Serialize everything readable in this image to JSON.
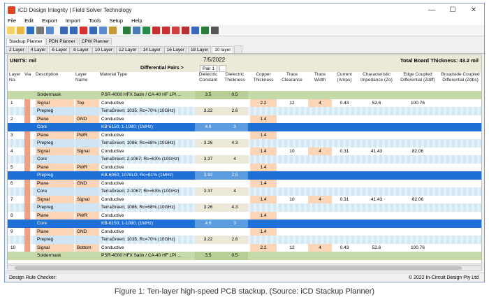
{
  "window": {
    "title": "iCD Design Integrity | Field Solver Technology",
    "minimize": "—",
    "maximize": "☐",
    "close": "✕"
  },
  "menu": [
    "File",
    "Edit",
    "Export",
    "Import",
    "Tools",
    "Setup",
    "Help"
  ],
  "toolbar_icons": [
    "new-file-icon",
    "open-folder-icon",
    "save-icon",
    "print-icon",
    "print-preview-icon",
    "undo-icon",
    "redo-icon",
    "delete-icon",
    "cut-icon",
    "copy-icon",
    "paste-icon",
    "stackup-icon",
    "impedance-chart-icon",
    "graph-icon",
    "graph-icon-2",
    "red-chart-icon",
    "red-chart-icon-2",
    "chart-icon-3",
    "chart-icon-4",
    "table-icon",
    "calendar-icon"
  ],
  "planner_tabs": [
    "Stackup Planner",
    "PDN Planner",
    "CPW Planner"
  ],
  "layer_tabs": [
    "2 Layer",
    "4 Layer",
    "6 Layer",
    "8 Layer",
    "10 Layer",
    "12 Layer",
    "14 Layer",
    "16 Layer",
    "18 Layer",
    "10 layer"
  ],
  "units": "UNITS: mil",
  "date": "7/5/2022",
  "total_thickness": "Total Board Thickness: 43.2 mil",
  "diff_pairs_label": "Differential Pairs >",
  "pair_tab": "Pair 1",
  "columns": {
    "layer_no": "Layer No.",
    "via": "Via",
    "description": "Description",
    "layer_name": "Layer Name",
    "material": "Material Type",
    "dk": "Dielectric Constant",
    "thickness": "Dielectric Thickness",
    "copper": "Copper Thickness",
    "clearance": "Trace Clearance",
    "width": "Trace Width",
    "current": "Current (Amps)",
    "zo": "Characteristic Impedance (Zo)",
    "zdiff": "Edge Coupled Differential (Zdiff)",
    "zdbs": "Broadside Coupled Differential (Zdbs)"
  },
  "rows": [
    {
      "type": "mask",
      "no": "",
      "desc": "Soldermask",
      "name": "",
      "mat": "PSR-4000 HFX Satin / CA-40 HF LPI ...",
      "dk": "3.5",
      "th": "0.5",
      "cu": "",
      "cl": "",
      "w": "",
      "cur": "",
      "zo": "",
      "zd": ""
    },
    {
      "type": "signal",
      "no": "1",
      "desc": "Signal",
      "name": "Top",
      "mat": "Conductive",
      "dk": "",
      "th": "",
      "cu": "2.2",
      "cl": "12",
      "w": "4",
      "cur": "0.43",
      "zo": "52.6",
      "zd": "100.76"
    },
    {
      "type": "preg",
      "no": "",
      "desc": "Prepreg",
      "name": "",
      "mat": "TerraGreen; 1035; Rc=70% (10GHz)",
      "dk": "3.22",
      "th": "2.6",
      "cu": "",
      "cl": "",
      "w": "",
      "cur": "",
      "zo": "",
      "zd": ""
    },
    {
      "type": "plane",
      "no": "2",
      "desc": "Plane",
      "name": "GND",
      "mat": "Conductive",
      "dk": "",
      "th": "",
      "cu": "1.4",
      "cl": "",
      "w": "",
      "cur": "",
      "zo": "",
      "zd": ""
    },
    {
      "type": "core",
      "no": "",
      "desc": "Core",
      "name": "",
      "mat": "KB-6150; 1-1080; (1MHz)",
      "dk": "4.6",
      "th": "3",
      "cu": "",
      "cl": "",
      "w": "",
      "cur": "",
      "zo": "",
      "zd": ""
    },
    {
      "type": "plane",
      "no": "3",
      "desc": "Plane",
      "name": "PWR",
      "mat": "Conductive",
      "dk": "",
      "th": "",
      "cu": "1.4",
      "cl": "",
      "w": "",
      "cur": "",
      "zo": "",
      "zd": ""
    },
    {
      "type": "preg",
      "no": "",
      "desc": "Prepreg",
      "name": "",
      "mat": "TerraGreen; 1086; Rc=68% (10GHz)",
      "dk": "3.26",
      "th": "4.3",
      "cu": "",
      "cl": "",
      "w": "",
      "cur": "",
      "zo": "",
      "zd": ""
    },
    {
      "type": "signal",
      "no": "4",
      "desc": "Signal",
      "name": "Signal",
      "mat": "Conductive",
      "dk": "",
      "th": "",
      "cu": "1.4",
      "cl": "10",
      "w": "4",
      "cur": "0.31",
      "zo": "41.43",
      "zd": "82.06"
    },
    {
      "type": "preg",
      "no": "",
      "desc": "Core",
      "name": "",
      "mat": "TerraGreen; 2-1067; Rc=63% (10GHz)",
      "dk": "3.37",
      "th": "4",
      "cu": "",
      "cl": "",
      "w": "",
      "cur": "",
      "zo": "",
      "zd": ""
    },
    {
      "type": "plane",
      "no": "5",
      "desc": "Plane",
      "name": "PWR",
      "mat": "Conductive",
      "dk": "",
      "th": "",
      "cu": "1.4",
      "cl": "",
      "w": "",
      "cur": "",
      "zo": "",
      "zd": ""
    },
    {
      "type": "core",
      "no": "",
      "desc": "Prepreg",
      "name": "",
      "mat": "KB-6050; 1078LD; Rc=61% (1MHz)",
      "dk": "3.92",
      "th": "2.6",
      "cu": "",
      "cl": "",
      "w": "",
      "cur": "",
      "zo": "",
      "zd": ""
    },
    {
      "type": "plane",
      "no": "6",
      "desc": "Plane",
      "name": "GND",
      "mat": "Conductive",
      "dk": "",
      "th": "",
      "cu": "1.4",
      "cl": "",
      "w": "",
      "cur": "",
      "zo": "",
      "zd": ""
    },
    {
      "type": "preg",
      "no": "",
      "desc": "Core",
      "name": "",
      "mat": "TerraGreen; 2-1067; Rc=63% (10GHz)",
      "dk": "3.37",
      "th": "4",
      "cu": "",
      "cl": "",
      "w": "",
      "cur": "",
      "zo": "",
      "zd": ""
    },
    {
      "type": "signal",
      "no": "7",
      "desc": "Signal",
      "name": "Signal",
      "mat": "Conductive",
      "dk": "",
      "th": "",
      "cu": "1.4",
      "cl": "10",
      "w": "4",
      "cur": "0.31",
      "zo": "41.43",
      "zd": "82.06"
    },
    {
      "type": "preg",
      "no": "",
      "desc": "Prepreg",
      "name": "",
      "mat": "TerraGreen; 1086; Rc=68% (10GHz)",
      "dk": "3.26",
      "th": "4.3",
      "cu": "",
      "cl": "",
      "w": "",
      "cur": "",
      "zo": "",
      "zd": ""
    },
    {
      "type": "plane",
      "no": "8",
      "desc": "Plane",
      "name": "PWR",
      "mat": "Conductive",
      "dk": "",
      "th": "",
      "cu": "1.4",
      "cl": "",
      "w": "",
      "cur": "",
      "zo": "",
      "zd": ""
    },
    {
      "type": "core",
      "no": "",
      "desc": "Core",
      "name": "",
      "mat": "KB-6150; 1-1080; (1MHz)",
      "dk": "4.6",
      "th": "3",
      "cu": "",
      "cl": "",
      "w": "",
      "cur": "",
      "zo": "",
      "zd": ""
    },
    {
      "type": "plane",
      "no": "9",
      "desc": "Plane",
      "name": "GND",
      "mat": "Conductive",
      "dk": "",
      "th": "",
      "cu": "1.4",
      "cl": "",
      "w": "",
      "cur": "",
      "zo": "",
      "zd": ""
    },
    {
      "type": "preg",
      "no": "",
      "desc": "Prepreg",
      "name": "",
      "mat": "TerraGreen; 1035; Rc=70% (10GHz)",
      "dk": "3.22",
      "th": "2.6",
      "cu": "",
      "cl": "",
      "w": "",
      "cur": "",
      "zo": "",
      "zd": ""
    },
    {
      "type": "signal",
      "no": "10",
      "desc": "Signal",
      "name": "Bottom",
      "mat": "Conductive",
      "dk": "",
      "th": "",
      "cu": "2.2",
      "cl": "12",
      "w": "4",
      "cur": "0.43",
      "zo": "52.6",
      "zd": "100.76"
    },
    {
      "type": "mask",
      "no": "",
      "desc": "Soldermask",
      "name": "",
      "mat": "PSR-4000 HFX Satin / CA-40 HF LPI ...",
      "dk": "3.5",
      "th": "0.5",
      "cu": "",
      "cl": "",
      "w": "",
      "cur": "",
      "zo": "",
      "zd": ""
    }
  ],
  "status_left": "Design Rule Checker:",
  "status_right": "© 2022 In-Circuit Design Pty Ltd",
  "caption": "Figure 1: Ten-layer high-speed PCB stackup. (Source: iCD Stackup Planner)",
  "colors": {
    "soldermask": "#c6d9a8",
    "core": "#1e6fd6",
    "prepreg": "#d9ecf8",
    "plane": "#fbd5b5",
    "via": "#f0a080"
  }
}
